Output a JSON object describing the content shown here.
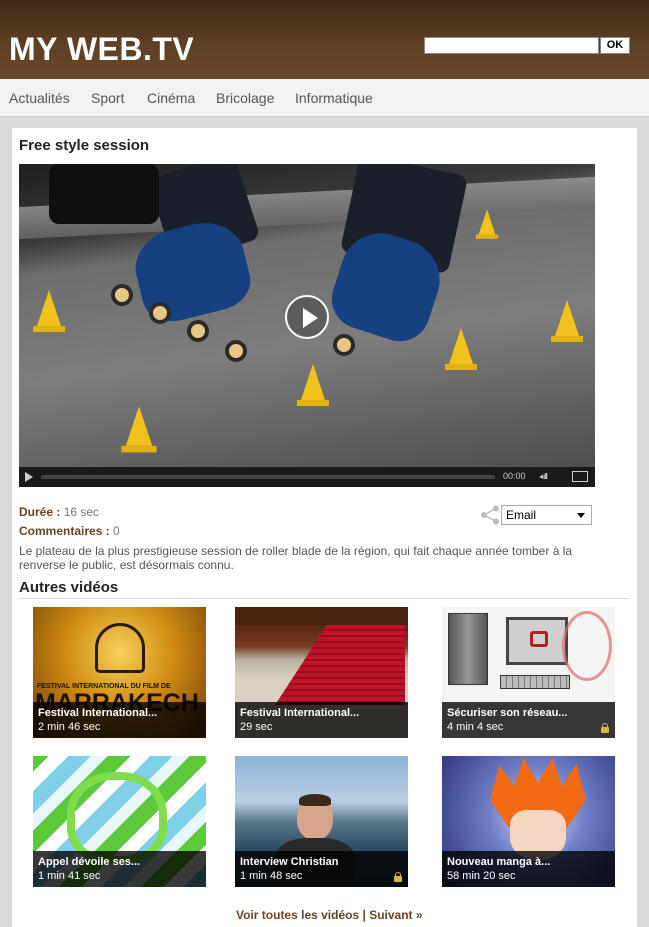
{
  "header": {
    "logo": "MY WEB.TV",
    "search": {
      "value": "",
      "button_label": "OK"
    }
  },
  "nav": {
    "items": [
      {
        "label": "Actualités"
      },
      {
        "label": "Sport"
      },
      {
        "label": "Cinéma"
      },
      {
        "label": "Bricolage"
      },
      {
        "label": "Informatique"
      }
    ]
  },
  "video": {
    "title": "Free style session",
    "current_time": "00:00",
    "progress": 0,
    "duration_label": "Durée :",
    "duration_value": "16 sec",
    "comments_label": "Commentaires :",
    "comments_value": "0",
    "description": "Le plateau de la plus prestigieuse session de roller blade de la région, qui fait chaque année tomber à la renverse le public, est désormais connu."
  },
  "share": {
    "icon": "share-icon",
    "selected": "Email"
  },
  "other_videos": {
    "title": "Autres vidéos",
    "items": [
      {
        "title": "Festival International...",
        "duration": "2 min 46 sec",
        "locked": false,
        "art_text": "FESTIVAL INTERNATIONAL DU FILM DE",
        "art_text2": "MARRAKECH"
      },
      {
        "title": "Festival International...",
        "duration": "29 sec",
        "locked": false
      },
      {
        "title": "Sécuriser son réseau...",
        "duration": "4 min 4 sec",
        "locked": true
      },
      {
        "title": "Appel dévoile ses...",
        "duration": "1 min 41 sec",
        "locked": false
      },
      {
        "title": "Interview Christian",
        "duration": "1 min 48 sec",
        "locked": true
      },
      {
        "title": "Nouveau manga à...",
        "duration": "58 min 20 sec",
        "locked": false
      }
    ]
  },
  "footer": {
    "all_videos": "Voir toutes les vidéos",
    "separator": "|",
    "next": "Suivant »"
  },
  "colors": {
    "header_brown": "#5c3f24",
    "link_brown": "#6b4222",
    "nav_bg": "#f2f2f2",
    "cone_yellow": "#f0c21b"
  }
}
